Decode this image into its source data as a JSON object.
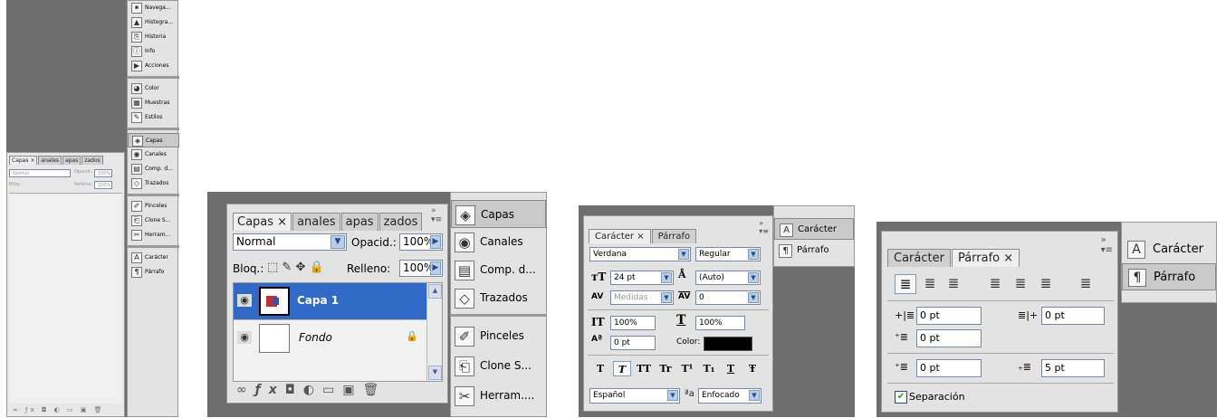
{
  "panel1": {
    "tabs": [
      "Capas ×",
      "anales",
      "apas",
      "zados"
    ],
    "blend_mode": "Normal",
    "opacity_label": "Opacid.:",
    "opacity_value": "100%",
    "lock_label": "Bloq.:",
    "fill_label": "Relleno:",
    "fill_value": "100%",
    "dock": [
      {
        "icon": "navigator-icon",
        "label": "Navega..."
      },
      {
        "icon": "histogram-icon",
        "label": "Histogra..."
      },
      {
        "icon": "history-icon",
        "label": "Historia"
      },
      {
        "icon": "info-icon",
        "label": "Info"
      },
      {
        "icon": "actions-icon",
        "label": "Acciones"
      },
      {
        "icon": "color-icon",
        "label": "Color"
      },
      {
        "icon": "swatches-icon",
        "label": "Muestras"
      },
      {
        "icon": "styles-icon",
        "label": "Estilos"
      },
      {
        "icon": "layers-icon",
        "label": "Capas"
      },
      {
        "icon": "channels-icon",
        "label": "Canales"
      },
      {
        "icon": "layer-comps-icon",
        "label": "Comp. d..."
      },
      {
        "icon": "paths-icon",
        "label": "Trazados"
      },
      {
        "icon": "brushes-icon",
        "label": "Pinceles"
      },
      {
        "icon": "clone-source-icon",
        "label": "Clone S..."
      },
      {
        "icon": "tool-presets-icon",
        "label": "Herram..."
      },
      {
        "icon": "character-icon",
        "label": "Carácter"
      },
      {
        "icon": "paragraph-icon",
        "label": "Párrafo"
      }
    ]
  },
  "panel2": {
    "tabs": [
      "Capas ×",
      "anales",
      "apas",
      "zados"
    ],
    "blend_mode": "Normal",
    "opacity_label": "Opacid.:",
    "opacity_value": "100%",
    "lock_label": "Bloq.:",
    "fill_label": "Relleno:",
    "fill_value": "100%",
    "layers": [
      {
        "name": "Capa 1",
        "selected": true
      },
      {
        "name": "Fondo",
        "selected": false
      }
    ],
    "dock_top": [
      {
        "icon": "layers-icon",
        "label": "Capas"
      },
      {
        "icon": "channels-icon",
        "label": "Canales"
      },
      {
        "icon": "layer-comps-icon",
        "label": "Comp. d..."
      },
      {
        "icon": "paths-icon",
        "label": "Trazados"
      }
    ],
    "dock_bottom": [
      {
        "icon": "brushes-icon",
        "label": "Pinceles"
      },
      {
        "icon": "clone-source-icon",
        "label": "Clone S..."
      },
      {
        "icon": "tool-presets-icon",
        "label": "Herram...."
      }
    ]
  },
  "panel3": {
    "tabs": [
      "Carácter ×",
      "Párrafo"
    ],
    "font_family": "Verdana",
    "font_style": "Regular",
    "font_size": "24 pt",
    "leading": "(Auto)",
    "kerning": "Medidas",
    "tracking": "0",
    "vertical_scale": "100%",
    "horizontal_scale": "100%",
    "baseline_shift": "0 pt",
    "color_label": "Color:",
    "text_styles": [
      "T",
      "T",
      "TT",
      "Tr",
      "T¹",
      "T₁",
      "T",
      "Ŧ"
    ],
    "language": "Español",
    "antialias_label": "ªa",
    "antialias": "Enfocado",
    "dock": [
      {
        "icon": "character-icon",
        "label": "Carácter"
      },
      {
        "icon": "paragraph-icon",
        "label": "Párrafo"
      }
    ]
  },
  "panel4": {
    "tabs": [
      "Carácter",
      "Párrafo ×"
    ],
    "indent_left": "0 pt",
    "indent_right": "0 pt",
    "indent_first": "0 pt",
    "space_before": "0 pt",
    "space_after": "5 pt",
    "hyphenation_label": "Separación",
    "hyphenation_checked": true,
    "dock": [
      {
        "icon": "character-icon",
        "label": "Carácter"
      },
      {
        "icon": "paragraph-icon",
        "label": "Párrafo"
      }
    ]
  },
  "colors": {
    "selection": "#3169c6",
    "chrome": "#e3e3e3",
    "workspace": "#6e6e6e",
    "dropdown": "#b9cdef"
  }
}
